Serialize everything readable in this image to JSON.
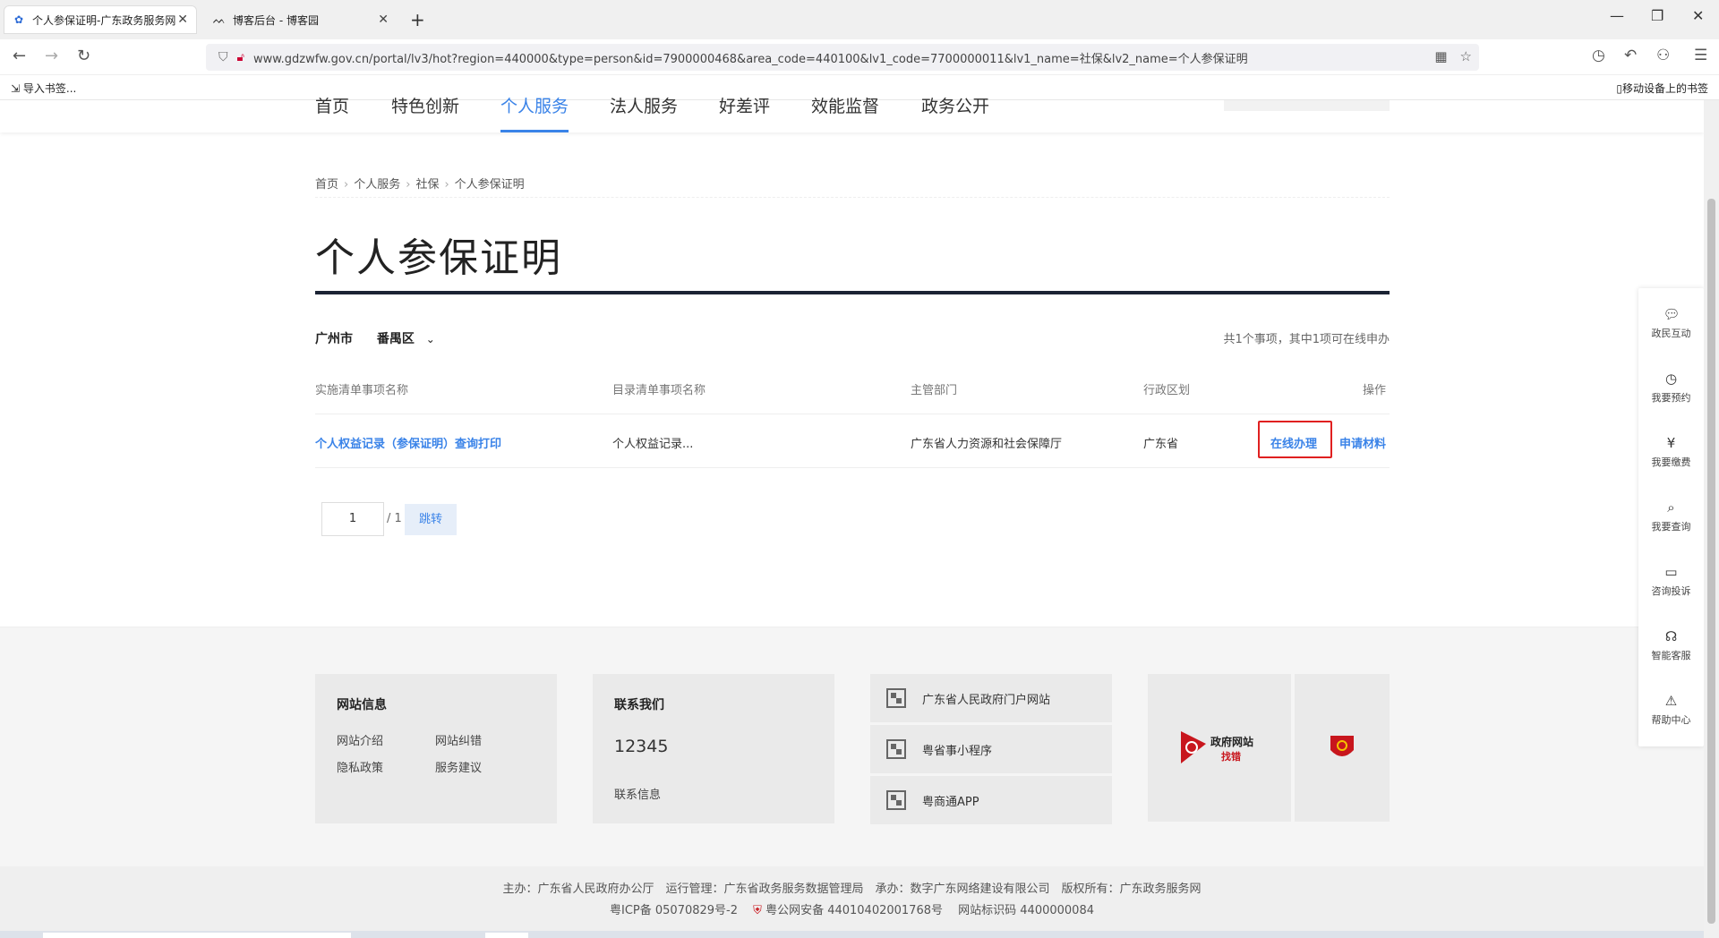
{
  "browser": {
    "tabs": [
      {
        "title": "个人参保证明-广东政务服务网",
        "favicon": "gear-flower-icon"
      },
      {
        "title": "博客后台 - 博客园",
        "favicon": "blog-icon"
      }
    ],
    "new_tab": "+",
    "url": "www.gdzwfw.gov.cn/portal/lv3/hot?region=440000&type=person&id=7900000468&area_code=440100&lv1_code=7700000011&lv1_name=社保&lv2_name=个人参保证明",
    "bookmarks": {
      "import": "导入书签...",
      "mobile": "移动设备上的书签"
    }
  },
  "site_nav": {
    "items": [
      "首页",
      "特色创新",
      "个人服务",
      "法人服务",
      "好差评",
      "效能监督",
      "政务公开"
    ],
    "active_index": 2
  },
  "breadcrumb": [
    "首页",
    "个人服务",
    "社保",
    "个人参保证明"
  ],
  "page_title": "个人参保证明",
  "region": {
    "city": "广州市",
    "district": "番禺区"
  },
  "summary": "共1个事项，其中1项可在线申办",
  "table": {
    "headers": [
      "实施清单事项名称",
      "目录清单事项名称",
      "主管部门",
      "行政区划",
      "操作"
    ],
    "rows": [
      {
        "name": "个人权益记录（参保证明）查询打印",
        "catalog": "个人权益记录...",
        "dept": "广东省人力资源和社会保障厅",
        "area": "广东省",
        "op_online": "在线办理",
        "op_material": "申请材料"
      }
    ]
  },
  "pager": {
    "current": "1",
    "total": "/ 1",
    "jump": "跳转"
  },
  "footer": {
    "site_info": {
      "title": "网站信息",
      "links": [
        "网站介绍",
        "网站纠错",
        "隐私政策",
        "服务建议"
      ]
    },
    "contact": {
      "title": "联系我们",
      "phone": "12345",
      "info": "联系信息"
    },
    "qr_links": [
      "广东省人民政府门户网站",
      "粤省事小程序",
      "粤商通APP"
    ],
    "logo_text": {
      "line1": "政府网站",
      "line2": "找错"
    },
    "copyright_line1": "主办：广东省人民政府办公厅　运行管理：广东省政务服务数据管理局　承办：数字广东网络建设有限公司　版权所有：广东政务服务网",
    "icp": "粤ICP备 05070829号-2",
    "police": "粤公网安备 44010402001768号",
    "site_code": "网站标识码 4400000084"
  },
  "float_bar": [
    "政民互动",
    "我要预约",
    "我要缴费",
    "我要查询",
    "咨询投诉",
    "智能客服",
    "帮助中心"
  ],
  "colors": {
    "accent": "#3a83e8",
    "highlight_border": "#e02020",
    "title_bar": "#1b2334"
  }
}
